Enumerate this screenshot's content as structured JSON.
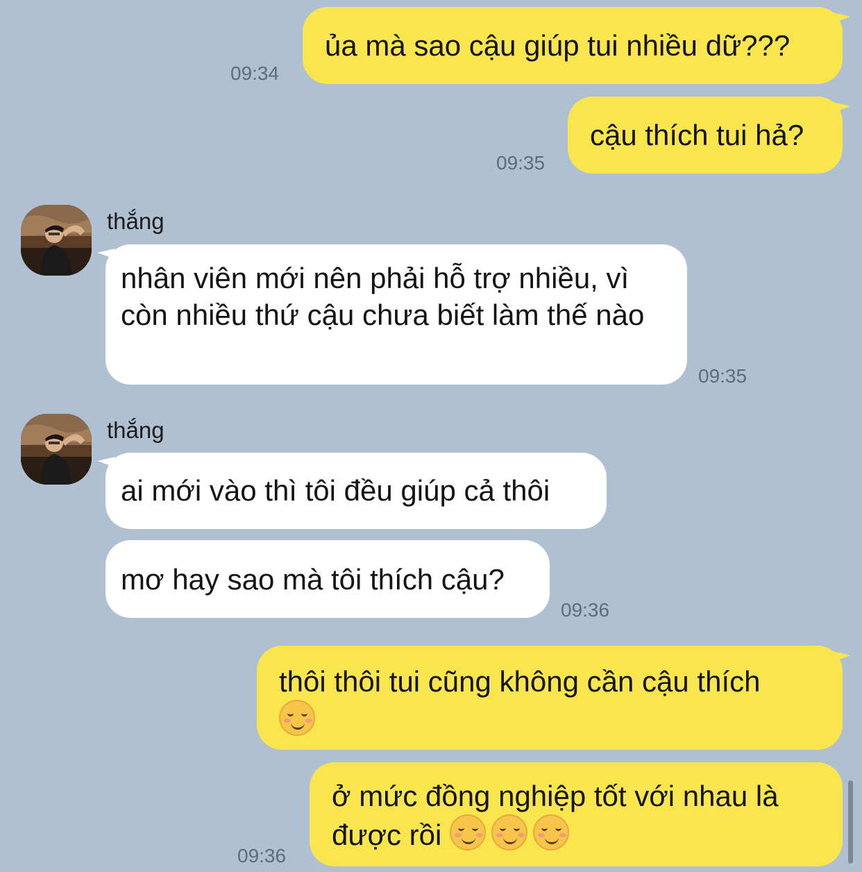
{
  "messages": [
    {
      "text": "ủa mà sao cậu giúp tui nhiều dữ???",
      "time": "09:34"
    },
    {
      "text": "cậu thích tui hả?",
      "time": "09:35"
    },
    {
      "sender": "thắng",
      "text": "nhân viên mới nên phải hỗ trợ nhiều, vì còn nhiều thứ cậu chưa biết làm thế nào",
      "time": "09:35"
    },
    {
      "sender": "thắng",
      "text": "ai mới vào thì tôi đều giúp cả thôi"
    },
    {
      "text": "mơ hay sao mà tôi thích cậu?",
      "time": "09:36"
    },
    {
      "text": "thôi thôi tui cũng không cần cậu thích",
      "emoji": "relieved-face-emoji"
    },
    {
      "text": "ở mức đồng nghiệp tốt với nhau là được rồi",
      "emoji": "relieved-face-emoji",
      "time": "09:36"
    }
  ],
  "colors": {
    "background": "#aec0d1",
    "my_bubble": "#f9e54e",
    "their_bubble": "#ffffff",
    "timestamp": "#5f6b78"
  }
}
